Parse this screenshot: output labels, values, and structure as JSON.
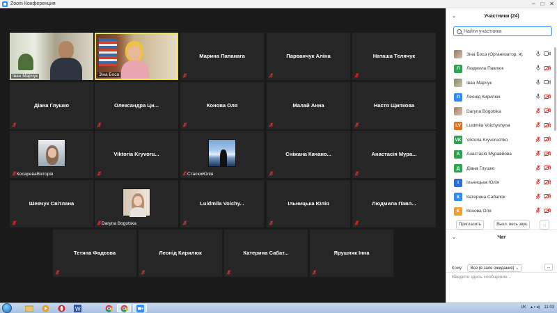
{
  "window": {
    "title": "Zoom Конференция",
    "controls": [
      "–",
      "□",
      "✕"
    ]
  },
  "grid": [
    {
      "name": "Іван Марчук",
      "type": "video",
      "muted": false,
      "photo": "man-office"
    },
    {
      "name": "Зіна Боса",
      "type": "video",
      "muted": false,
      "active": true,
      "photo": "woman-office"
    },
    {
      "name": "Марина Папанага",
      "type": "name",
      "muted": true
    },
    {
      "name": "Парванчук Аліна",
      "type": "name",
      "muted": true
    },
    {
      "name": "Наташа Телячук",
      "type": "name",
      "muted": true
    },
    {
      "name": "Діана Глушко",
      "type": "name",
      "muted": true
    },
    {
      "name": "Олександра  Ци...",
      "type": "name",
      "muted": true
    },
    {
      "name": "Конова Оля",
      "type": "name",
      "muted": true
    },
    {
      "name": "Малай Анна",
      "type": "name",
      "muted": true
    },
    {
      "name": "Настя Щипкова",
      "type": "name",
      "muted": true
    },
    {
      "name": "КосаревaВікторія",
      "type": "photo",
      "muted": true,
      "photo": "girl-snow"
    },
    {
      "name": "Viktoria  Kryvoru...",
      "type": "name",
      "muted": true
    },
    {
      "name": "СтасюкЮлія",
      "type": "photo",
      "muted": true,
      "photo": "girl-lake"
    },
    {
      "name": "Сніжана  Качано...",
      "type": "name",
      "muted": true
    },
    {
      "name": "Анастасія  Мура...",
      "type": "name",
      "muted": true
    },
    {
      "name": "Шевчук Світлана",
      "type": "name",
      "muted": true
    },
    {
      "name": "Daryna Bogotska",
      "type": "photo",
      "muted": true,
      "photo": "girl-room"
    },
    {
      "name": "Luidmila  Voichy...",
      "type": "name",
      "muted": true
    },
    {
      "name": "Ільницька Юлія",
      "type": "name",
      "muted": true
    },
    {
      "name": "Людмила  Павл...",
      "type": "name",
      "muted": true
    },
    {
      "name": "Тетяна Фадєєва",
      "type": "name",
      "muted": true
    },
    {
      "name": "Леонід Кирилюк",
      "type": "name",
      "muted": true
    },
    {
      "name": "Катерина  Сабат...",
      "type": "name",
      "muted": true
    },
    {
      "name": "Ярушняк Інна",
      "type": "name",
      "muted": true
    }
  ],
  "participants": {
    "title": "Участники (24)",
    "search_placeholder": "Найти участника",
    "list": [
      {
        "name": "Зіна Боса (Организатор, я)",
        "initials": "",
        "color": "#8a7a6a",
        "photo": true,
        "mic": "on",
        "cam": "on"
      },
      {
        "name": "Людмила Павлюк",
        "initials": "Л",
        "color": "#2ea44f",
        "mic": "on",
        "cam": "off"
      },
      {
        "name": "Іван Марчук",
        "initials": "",
        "color": "#7a8a6a",
        "photo": true,
        "mic": "on",
        "cam": "on"
      },
      {
        "name": "Леонід Кирилюк",
        "initials": "Л",
        "color": "#2d8cff",
        "mic": "on",
        "cam": "off"
      },
      {
        "name": "Daryna Bogotska",
        "initials": "",
        "color": "#a08070",
        "photo": true,
        "mic": "off",
        "cam": "off"
      },
      {
        "name": "Luidmila Voichyshyna",
        "initials": "LV",
        "color": "#e0701e",
        "mic": "off",
        "cam": "off"
      },
      {
        "name": "Viktoria Kryvoruchko",
        "initials": "VK",
        "color": "#2ea44f",
        "mic": "off",
        "cam": "off"
      },
      {
        "name": "Анастасія Муравйова",
        "initials": "А",
        "color": "#2ea44f",
        "mic": "off",
        "cam": "off"
      },
      {
        "name": "Діана Глушко",
        "initials": "Д",
        "color": "#2ea44f",
        "mic": "off",
        "cam": "off"
      },
      {
        "name": "Ільницька Юлія",
        "initials": "І",
        "color": "#2d6fd6",
        "mic": "off",
        "cam": "off"
      },
      {
        "name": "Катерина Сабапок",
        "initials": "К",
        "color": "#2d8cff",
        "mic": "off",
        "cam": "off"
      },
      {
        "name": "Конова Оля",
        "initials": "К",
        "color": "#f0a030",
        "mic": "off",
        "cam": "off"
      }
    ],
    "buttons": {
      "invite": "Пригласить",
      "mute_all": "Выкл. весь звук",
      "more": "..."
    }
  },
  "chat": {
    "title": "Чат",
    "to_label": "Кому:",
    "to_value": "Все (в зале ожидания)",
    "input_placeholder": "Введите здесь сообщение...",
    "more": "..."
  },
  "taskbar": {
    "apps": [
      "folder",
      "media-player",
      "opera",
      "word",
      "chrome",
      "chrome",
      "zoom"
    ],
    "lang": "UK",
    "time": "11:03"
  },
  "colors": {
    "accent": "#2d8cff",
    "muted_red": "#e5322d",
    "active_border": "#e8e35a"
  }
}
